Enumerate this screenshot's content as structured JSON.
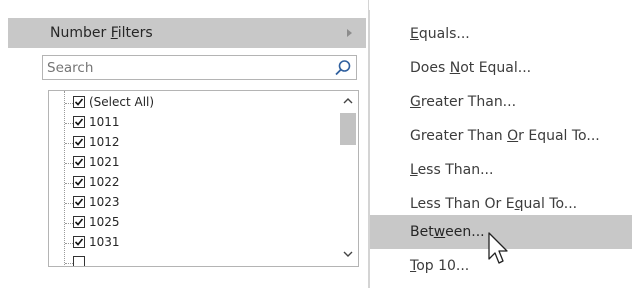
{
  "number_filters": {
    "label_before": "Number ",
    "accel": "F",
    "label_after": "ilters"
  },
  "search": {
    "placeholder": "Search"
  },
  "list": {
    "items": [
      {
        "label": "(Select All)",
        "checked": true
      },
      {
        "label": "1011",
        "checked": true
      },
      {
        "label": "1012",
        "checked": true
      },
      {
        "label": "1021",
        "checked": true
      },
      {
        "label": "1022",
        "checked": true
      },
      {
        "label": "1023",
        "checked": true
      },
      {
        "label": "1025",
        "checked": true
      },
      {
        "label": "1031",
        "checked": true
      }
    ]
  },
  "submenu": {
    "items": [
      {
        "label_before": "",
        "accel": "E",
        "label_after": "quals..."
      },
      {
        "label_before": "Does ",
        "accel": "N",
        "label_after": "ot Equal..."
      },
      {
        "label_before": "",
        "accel": "G",
        "label_after": "reater Than..."
      },
      {
        "label_before": "Greater Than ",
        "accel": "O",
        "label_after": "r Equal To..."
      },
      {
        "label_before": "",
        "accel": "L",
        "label_after": "ess Than..."
      },
      {
        "label_before": "Less Than Or E",
        "accel": "q",
        "label_after": "ual To..."
      },
      {
        "label_before": "Bet",
        "accel": "w",
        "label_after": "een..."
      },
      {
        "label_before": "",
        "accel": "T",
        "label_after": "op 10..."
      }
    ]
  },
  "colors": {
    "highlight": "#c8c8c8",
    "text": "#262626",
    "border": "#b4b4b4"
  },
  "icons": {
    "search": "magnifier-icon",
    "arrow": "triangle-right-icon",
    "check": "checkmark-icon",
    "cursor": "mouse-pointer-icon"
  }
}
